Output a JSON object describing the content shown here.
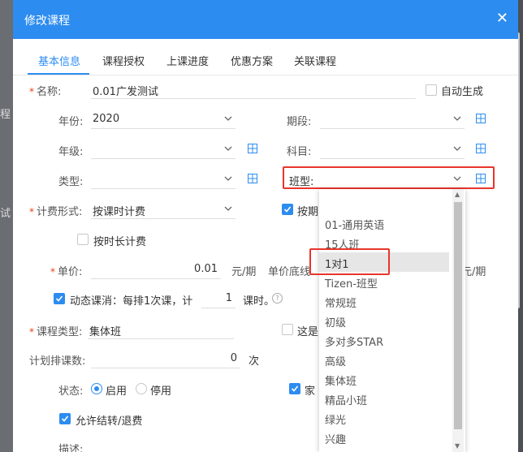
{
  "background": {
    "left_text_1": "程",
    "left_text_2": "试"
  },
  "dialog": {
    "title": "修改课程",
    "close_symbol": "✕"
  },
  "tabs": [
    "基本信息",
    "课程授权",
    "上课进度",
    "优惠方案",
    "关联课程"
  ],
  "form": {
    "name_label": "名称:",
    "name_value": "0.01广发测试",
    "auto_generate": "自动生成",
    "year_label": "年份:",
    "year_value": "2020",
    "period_label": "期段:",
    "grade_label": "年级:",
    "subject_label": "科目:",
    "type_label": "类型:",
    "class_type_label": "班型:",
    "billing_label": "计费形式:",
    "billing_value": "按课时计费",
    "billing_by_period": "按期",
    "billing_by_duration": "按时长计费",
    "price_label": "单价:",
    "price_value": "0.01",
    "price_unit": "元/期",
    "price_floor_label": "单价底线",
    "price_floor_unit": "元/期",
    "dynamic_label": "动态课消：每排1次课，计",
    "dynamic_value": "1",
    "dynamic_unit": "课时。",
    "course_type_label": "课程类型:",
    "course_type_value": "集体班",
    "is_label": "这是",
    "plan_count_label": "计划排课数:",
    "plan_count_value": "0",
    "plan_count_unit": "次",
    "status_label": "状态:",
    "status_enabled": "启用",
    "status_disabled": "停用",
    "home_label": "家",
    "allow_transfer": "允许结转/退费",
    "desc_label": "描述:"
  },
  "dropdown": {
    "items": [
      "01-通用英语",
      "15人班",
      "1对1",
      "Tizen-班型",
      "常规班",
      "初级",
      "多对多STAR",
      "高级",
      "集体班",
      "精品小班",
      "绿光",
      "兴趣"
    ],
    "selected": "1对1"
  },
  "colors": {
    "primary": "#2d8cf0",
    "highlight_border": "#e8352c",
    "required": "#ed4014"
  }
}
